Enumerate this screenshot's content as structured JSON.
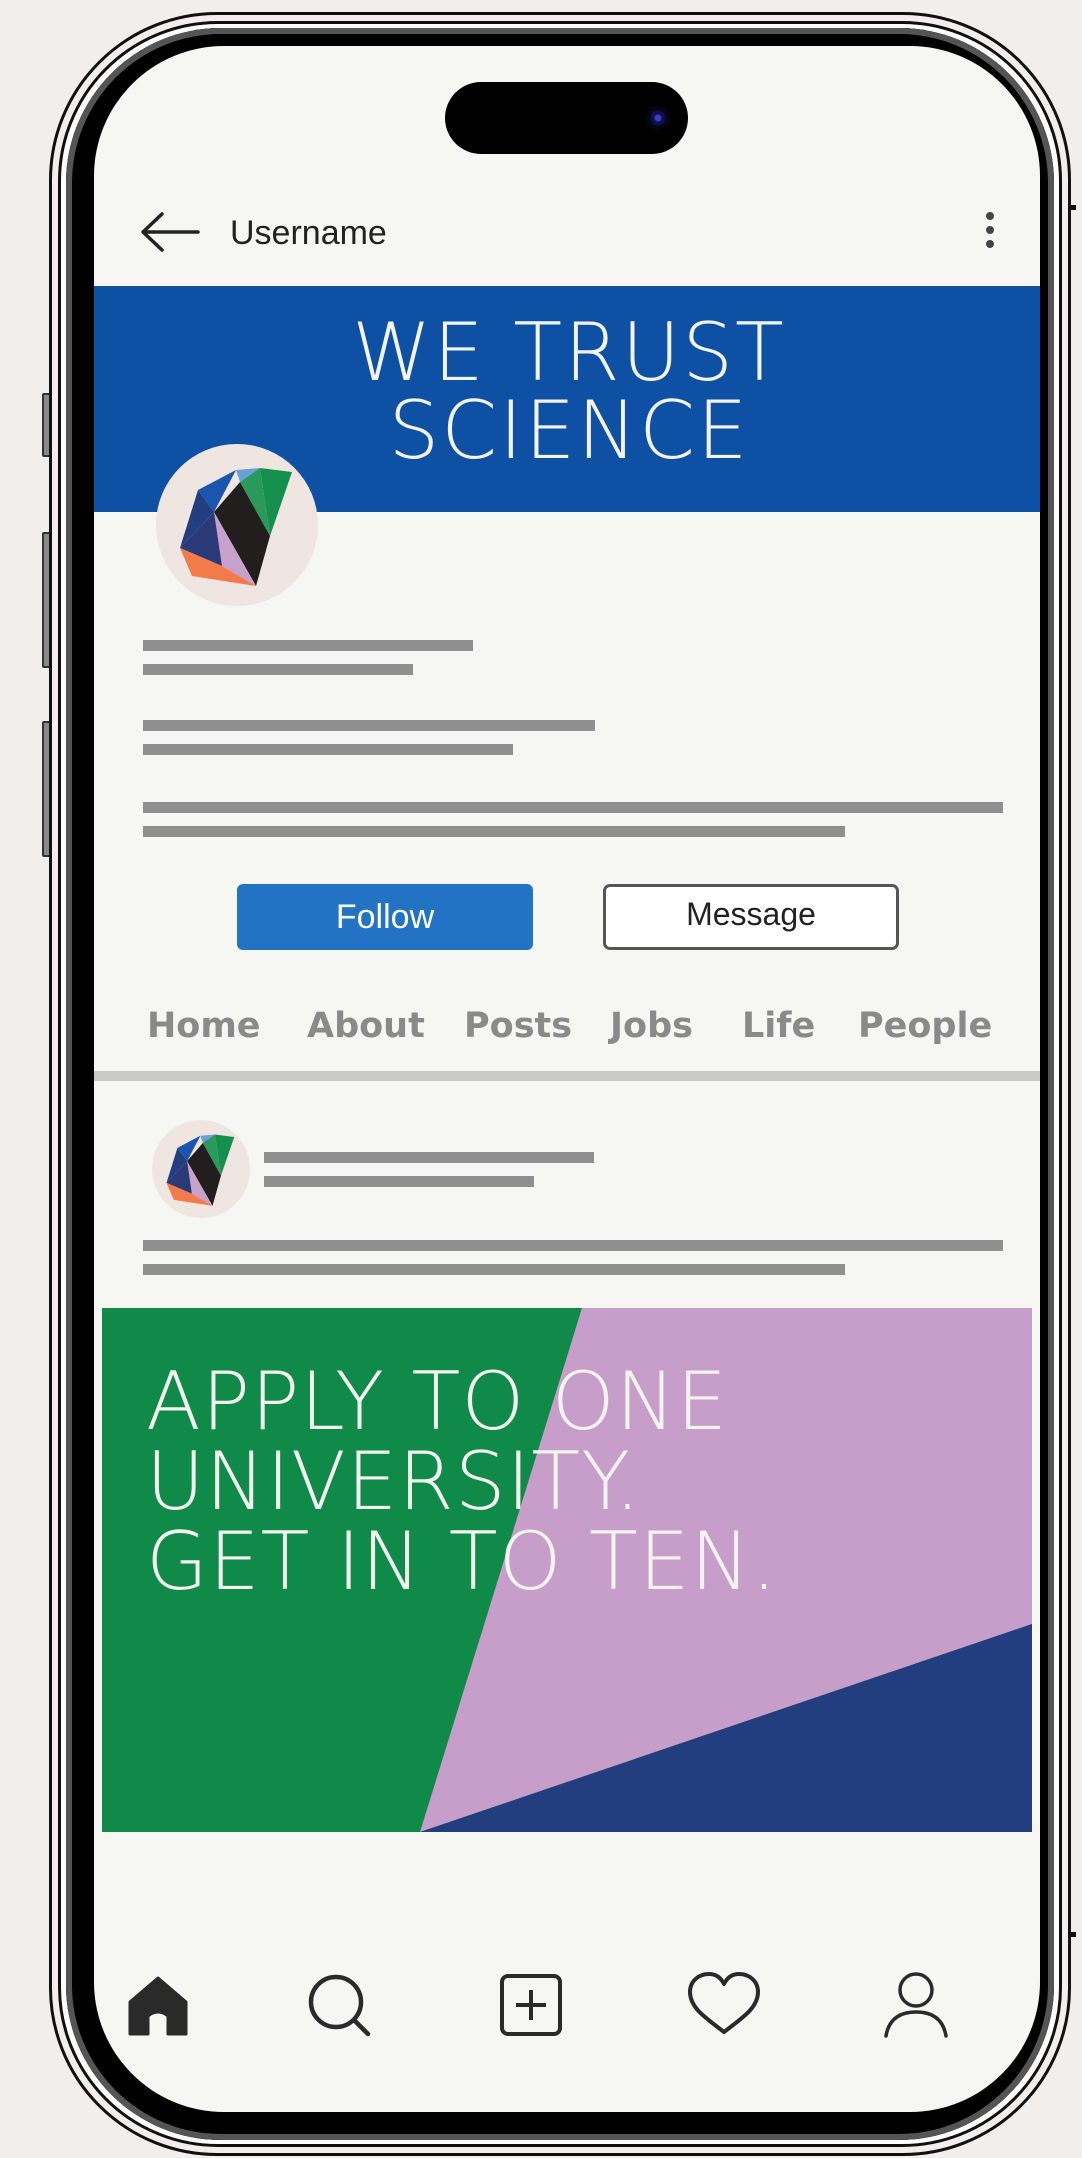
{
  "header": {
    "username": "Username",
    "back_icon": "arrow-left-icon",
    "more_icon": "vertical-ellipsis-icon"
  },
  "banner": {
    "title_line1": "WE TRUST",
    "title_line2": "SCIENCE",
    "background_color": "#0e51a4"
  },
  "profile": {
    "avatar_icon": "company-logo-icon",
    "follow_label": "Follow",
    "message_label": "Message",
    "follow_color": "#2273c3"
  },
  "tabs": [
    {
      "label": "Home"
    },
    {
      "label": "About"
    },
    {
      "label": "Posts"
    },
    {
      "label": "Jobs"
    },
    {
      "label": "Life"
    },
    {
      "label": "People"
    }
  ],
  "post": {
    "avatar_icon": "company-logo-icon",
    "headline_line1": "APPLY TO ONE",
    "headline_line2": "UNIVERSITY.",
    "headline_line3": "GET IN TO TEN.",
    "colors": {
      "green": "#0f8a48",
      "lilac": "#c79ec9",
      "navy": "#223e7e"
    }
  },
  "bottom_nav": [
    {
      "icon": "home-icon"
    },
    {
      "icon": "search-icon"
    },
    {
      "icon": "add-post-icon"
    },
    {
      "icon": "heart-icon"
    },
    {
      "icon": "profile-icon"
    }
  ]
}
